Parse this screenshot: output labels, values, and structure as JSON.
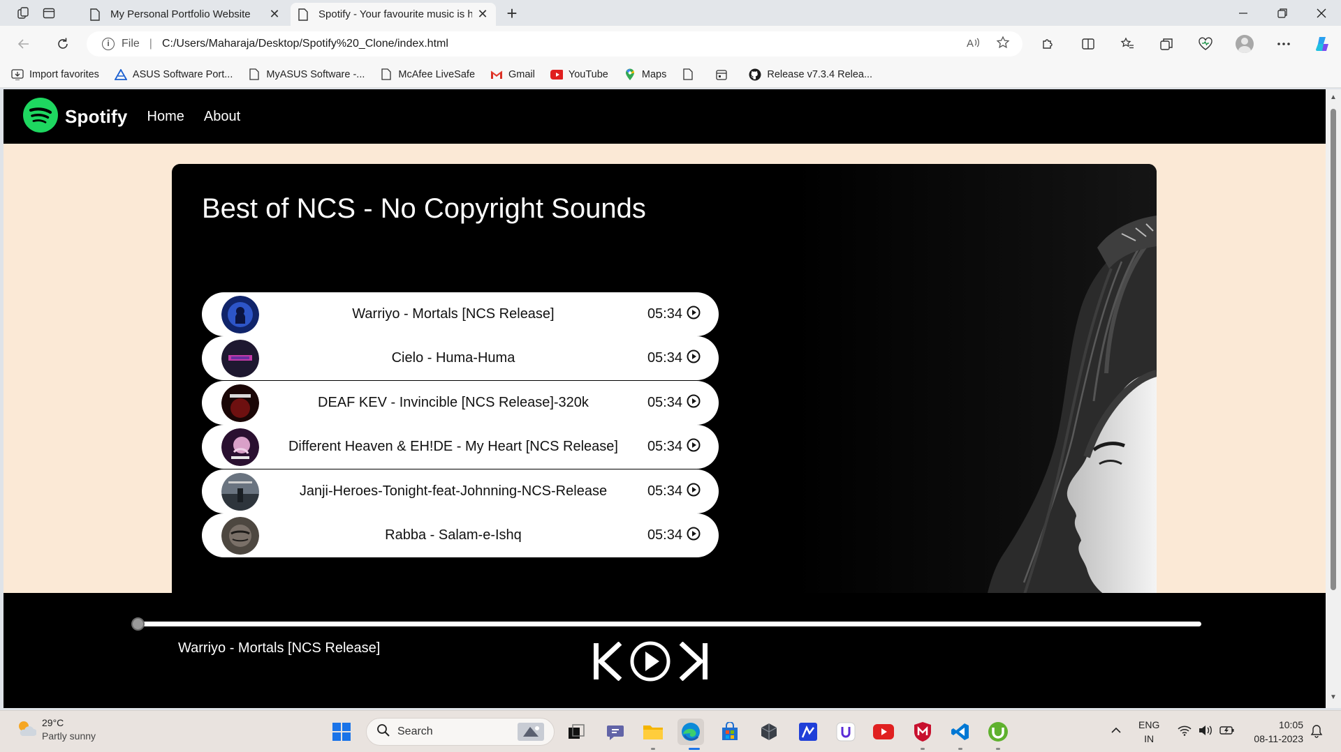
{
  "browser": {
    "tabs": [
      {
        "title": "My Personal Portfolio Website"
      },
      {
        "title": "Spotify - Your favourite music is here"
      }
    ],
    "address": {
      "scheme": "File",
      "url": "C:/Users/Maharaja/Desktop/Spotify%20_Clone/index.html"
    },
    "favorites": [
      {
        "label": "Import favorites",
        "icon": "import-icon"
      },
      {
        "label": "ASUS Software Port...",
        "icon": "asus-icon"
      },
      {
        "label": "MyASUS Software -...",
        "icon": "page-icon"
      },
      {
        "label": "McAfee LiveSafe",
        "icon": "page-icon"
      },
      {
        "label": "Gmail",
        "icon": "gmail-icon"
      },
      {
        "label": "YouTube",
        "icon": "youtube-icon"
      },
      {
        "label": "Maps",
        "icon": "maps-icon"
      },
      {
        "label": "Release v7.3.4 Relea...",
        "icon": "github-icon"
      }
    ]
  },
  "site": {
    "brand": "Spotify",
    "nav": [
      {
        "label": "Home"
      },
      {
        "label": "About"
      }
    ],
    "playlist_title": "Best of NCS - No Copyright Sounds",
    "songs": [
      {
        "name": "Warriyo - Mortals [NCS Release]",
        "time": "05:34",
        "thumb_color": "#1b3a8c"
      },
      {
        "name": "Cielo - Huma-Huma",
        "time": "05:34",
        "thumb_color": "#2a1f3d"
      },
      {
        "name": "DEAF KEV - Invincible [NCS Release]-320k",
        "time": "05:34",
        "thumb_color": "#5a0d0d"
      },
      {
        "name": "Different Heaven & EH!DE - My Heart [NCS Release]",
        "time": "05:34",
        "thumb_color": "#7a3a6a"
      },
      {
        "name": "Janji-Heroes-Tonight-feat-Johnning-NCS-Release",
        "time": "05:34",
        "thumb_color": "#4a5560"
      },
      {
        "name": "Rabba - Salam-e-Ishq",
        "time": "05:34",
        "thumb_color": "#5e574f"
      }
    ],
    "player": {
      "now_playing": "Warriyo - Mortals [NCS Release]",
      "progress": 0
    }
  },
  "taskbar": {
    "weather": {
      "temp": "29°C",
      "condition": "Partly sunny"
    },
    "search_placeholder": "Search",
    "lang": {
      "line1": "ENG",
      "line2": "IN"
    },
    "clock": {
      "time": "10:05",
      "date": "08-11-2023"
    }
  },
  "colors": {
    "page_bg": "#fbe9d6",
    "spotify_green": "#1ed760",
    "player_bg": "#000000"
  }
}
